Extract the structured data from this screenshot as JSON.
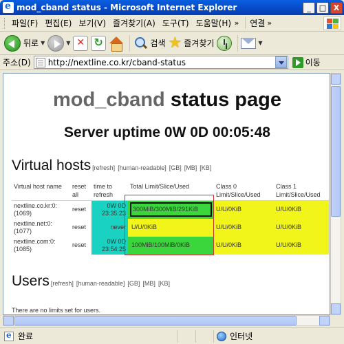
{
  "window": {
    "title": "mod_cband status - Microsoft Internet Explorer",
    "controls": [
      "_",
      "□",
      "X"
    ]
  },
  "menu": {
    "items": [
      "파일(F)",
      "편집(E)",
      "보기(V)",
      "즐겨찾기(A)",
      "도구(T)",
      "도움말(H)"
    ],
    "more": "»",
    "links_label": "연결",
    "links_more": "»"
  },
  "toolbar": {
    "back_label": "뒤로",
    "search_label": "검색",
    "favorites_label": "즐겨찾기"
  },
  "address": {
    "label": "주소(D)",
    "url": "http://nextline.co.kr/cband-status",
    "go_label": "이동"
  },
  "page": {
    "title_part1": "mod_cband",
    "title_part2": "status page",
    "uptime": "Server uptime 0W 0D 00:05:48",
    "virtual_hosts": {
      "heading": "Virtual hosts",
      "links": [
        "[refresh]",
        "[human-readable]",
        "[GB]",
        "[MB]",
        "[KB]"
      ],
      "columns": [
        "Virtual host name",
        "reset all",
        "time to refresh",
        "Total Limit/Slice/Used",
        "Class 0 Limit/Slice/Used",
        "Class 1 Limit/Slice/Used"
      ],
      "rows": [
        {
          "host": "nextline.co.kr:0:",
          "port": "(1069)",
          "reset": "reset",
          "refresh_1": "0W 0D",
          "refresh_2": "23:35:23",
          "total": "300MiB/300MiB/291KiB",
          "class0": "U/U/0KiB",
          "class1": "U/U/0KiB"
        },
        {
          "host": "nextline.net:0:",
          "port": "(1077)",
          "reset": "reset",
          "refresh_1": "never",
          "refresh_2": "",
          "total": "U/U/0KiB",
          "class0": "U/U/0KiB",
          "class1": "U/U/0KiB"
        },
        {
          "host": "nextline.com:0:",
          "port": "(1085)",
          "reset": "reset",
          "refresh_1": "0W 0D",
          "refresh_2": "23:54:25",
          "total": "100MiB/100MiB/0KiB",
          "class0": "U/U/0KiB",
          "class1": "U/U/0KiB"
        }
      ]
    },
    "users": {
      "heading": "Users",
      "links": [
        "[refresh]",
        "[human-readable]",
        "[GB]",
        "[MB]",
        "[KB]"
      ],
      "note": "There are no limits set for users."
    }
  },
  "status": {
    "text": "완료",
    "zone": "인터넷"
  },
  "colors": {
    "cyan": "#19d2c1",
    "green": "#3bd63b",
    "yellow": "#f2f51a",
    "highlight": "#c9302c"
  }
}
